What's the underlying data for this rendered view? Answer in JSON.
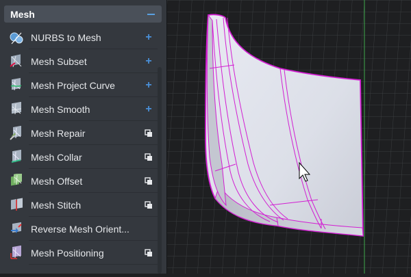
{
  "panel": {
    "title": "Mesh",
    "items": [
      {
        "label": "NURBS to Mesh",
        "icon": "nurbs-to-mesh-icon",
        "action": "add"
      },
      {
        "label": "Mesh Subset",
        "icon": "mesh-subset-icon",
        "action": "add"
      },
      {
        "label": "Mesh Project Curve",
        "icon": "mesh-project-curve-icon",
        "action": "add"
      },
      {
        "label": "Mesh Smooth",
        "icon": "mesh-smooth-icon",
        "action": "add"
      },
      {
        "label": "Mesh Repair",
        "icon": "mesh-repair-icon",
        "action": "window"
      },
      {
        "label": "Mesh Collar",
        "icon": "mesh-collar-icon",
        "action": "window"
      },
      {
        "label": "Mesh Offset",
        "icon": "mesh-offset-icon",
        "action": "window"
      },
      {
        "label": "Mesh Stitch",
        "icon": "mesh-stitch-icon",
        "action": "window"
      },
      {
        "label": "Reverse Mesh Orient...",
        "icon": "reverse-mesh-orient-icon",
        "action": "none"
      },
      {
        "label": "Mesh Positioning",
        "icon": "mesh-positioning-icon",
        "action": "window"
      }
    ]
  },
  "viewport": {
    "selection_color": "#d21ed2",
    "surface_color": "#dcdfe8",
    "grid_color": "#3a3d40",
    "background_color": "#1e1f21"
  },
  "colors": {
    "panel_bg": "#34383e",
    "header_bg": "#4a5059",
    "accent": "#4a90d9"
  }
}
